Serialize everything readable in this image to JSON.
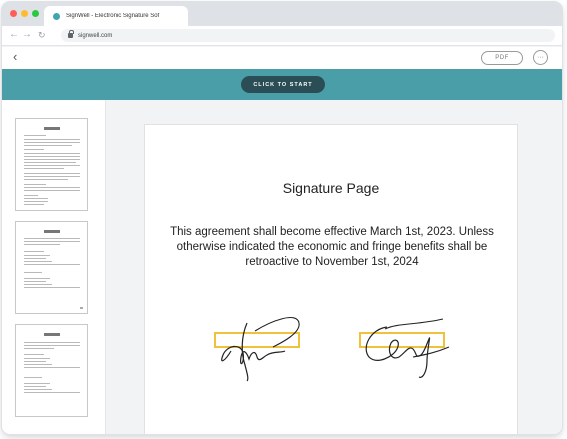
{
  "browser": {
    "tab_title": "SignWell - Electronic Signature Sof",
    "url": "signwell.com"
  },
  "app": {
    "pdf_label": "PDF",
    "more_label": "···",
    "start_label": "CLICK TO START"
  },
  "document": {
    "title": "Signature Page",
    "body": "This agreement shall become effective March 1st, 2023. Unless otherwise indicated the economic and fringe benefits shall be retroactive to November 1st, 2024"
  },
  "colors": {
    "accent_bar": "#4a9ea8",
    "start_button": "#2b4e56",
    "signature_field_border": "#f0c23c"
  },
  "icons": [
    "back-arrow-icon",
    "forward-arrow-icon",
    "reload-icon",
    "lock-icon",
    "chevron-left-icon",
    "more-options-icon"
  ],
  "thumbnails": [
    {
      "page": 1
    },
    {
      "page": 2
    },
    {
      "page": 3
    }
  ]
}
